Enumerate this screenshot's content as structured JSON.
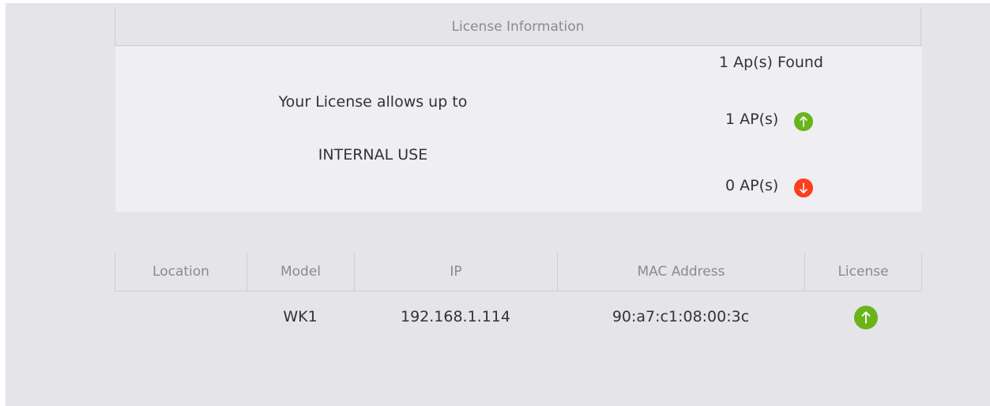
{
  "license": {
    "header": "License Information",
    "allows_text": "Your License allows up to",
    "usage_type": "INTERNAL USE",
    "found_text": "1 Ap(s) Found",
    "licensed_count": "1 AP(s)",
    "unlicensed_count": "0 AP(s)"
  },
  "table": {
    "columns": [
      "Location",
      "Model",
      "IP",
      "MAC Address",
      "License"
    ],
    "rows": [
      {
        "location": "",
        "model": "WK1",
        "ip": "192.168.1.114",
        "mac": "90:a7:c1:08:00:3c",
        "license": "up-arrow-icon"
      }
    ]
  },
  "colors": {
    "licensed": "#6ab41b",
    "unlicensed": "#fb3e1c",
    "panel_bg": "#e5e4e9"
  }
}
